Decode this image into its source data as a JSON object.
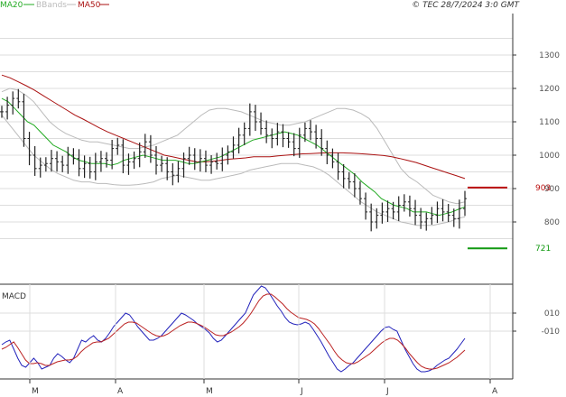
{
  "header": {
    "legend": [
      {
        "label": "MA20",
        "color": "#22aa22"
      },
      {
        "label": "BBands",
        "color": "#bbbbbb"
      },
      {
        "label": "MA50",
        "color": "#aa1111"
      }
    ],
    "copyright": "© TEC 28/7/2024 3:0 GMT"
  },
  "panels": {
    "macd_label": "MACD"
  },
  "chart_data": [
    {
      "type": "candlestick",
      "title": "",
      "ylim": [
        690,
        1400
      ],
      "yticks": [
        800,
        900,
        1000,
        1100,
        1200,
        1300
      ],
      "ytick_labels": [
        "800",
        "900",
        "1000",
        "1100",
        "1200",
        "1300"
      ],
      "xtick_labels": [
        "M",
        "A",
        "M",
        "J",
        "J",
        "A"
      ],
      "xtick_index": [
        8,
        30,
        52,
        74,
        96,
        118
      ],
      "closes": [
        1130,
        1150,
        1170,
        1160,
        1050,
        1000,
        960,
        970,
        975,
        990,
        980,
        970,
        1000,
        990,
        960,
        975,
        950,
        980,
        990,
        985,
        1020,
        1030,
        970,
        980,
        990,
        1010,
        1040,
        1000,
        970,
        975,
        950,
        940,
        960,
        990,
        1000,
        980,
        990,
        970,
        980,
        975,
        1000,
        1010,
        1030,
        1060,
        1080,
        1130,
        1100,
        1080,
        1060,
        1050,
        1070,
        1050,
        1040,
        1020,
        1060,
        1080,
        1070,
        1050,
        1020,
        1000,
        980,
        950,
        930,
        920,
        900,
        870,
        830,
        800,
        820,
        830,
        840,
        830,
        850,
        860,
        840,
        820,
        800,
        810,
        820,
        840,
        830,
        820,
        810,
        840,
        870
      ],
      "series": [
        {
          "name": "MA20",
          "color": "#22aa22",
          "values": [
            1170,
            1160,
            1140,
            1120,
            1100,
            1090,
            1070,
            1050,
            1030,
            1020,
            1010,
            995,
            985,
            980,
            975,
            975,
            975,
            970,
            975,
            985,
            990,
            995,
            1000,
            995,
            990,
            985,
            985,
            985,
            980,
            975,
            975,
            980,
            985,
            990,
            995,
            1005,
            1015,
            1025,
            1035,
            1045,
            1050,
            1055,
            1060,
            1065,
            1070,
            1065,
            1060,
            1050,
            1040,
            1030,
            1015,
            1000,
            985,
            970,
            955,
            940,
            920,
            905,
            890,
            870,
            860,
            850,
            845,
            840,
            830,
            830,
            830,
            825,
            820,
            825,
            830,
            838,
            845
          ]
        },
        {
          "name": "MA50",
          "color": "#aa1111",
          "values": [
            1240,
            1232,
            1220,
            1208,
            1195,
            1180,
            1165,
            1150,
            1135,
            1120,
            1108,
            1095,
            1082,
            1070,
            1060,
            1050,
            1040,
            1030,
            1020,
            1010,
            1000,
            995,
            990,
            985,
            980,
            980,
            982,
            985,
            988,
            990,
            992,
            995,
            995,
            995,
            998,
            1000,
            1002,
            1004,
            1005,
            1006,
            1007,
            1007,
            1007,
            1006,
            1005,
            1003,
            1001,
            999,
            995,
            990,
            984,
            978,
            970,
            962,
            954,
            946,
            938,
            930
          ]
        },
        {
          "name": "BBands",
          "color": "#bbbbbb",
          "upper": [
            1190,
            1200,
            1195,
            1180,
            1160,
            1130,
            1100,
            1080,
            1065,
            1055,
            1045,
            1040,
            1040,
            1035,
            1030,
            1025,
            1020,
            1020,
            1025,
            1030,
            1040,
            1050,
            1060,
            1080,
            1100,
            1120,
            1135,
            1140,
            1140,
            1135,
            1130,
            1120,
            1110,
            1100,
            1095,
            1090,
            1090,
            1095,
            1100,
            1110,
            1120,
            1130,
            1140,
            1140,
            1135,
            1125,
            1110,
            1080,
            1040,
            1000,
            960,
            935,
            920,
            900,
            880,
            870,
            860,
            855,
            860
          ],
          "lower": [
            1120,
            1090,
            1060,
            1030,
            1000,
            980,
            960,
            945,
            935,
            925,
            920,
            920,
            915,
            915,
            912,
            910,
            910,
            912,
            915,
            920,
            930,
            935,
            940,
            935,
            930,
            925,
            925,
            930,
            935,
            940,
            945,
            955,
            960,
            965,
            970,
            975,
            975,
            975,
            970,
            965,
            955,
            940,
            920,
            900,
            880,
            860,
            845,
            830,
            820,
            810,
            800,
            795,
            790,
            790,
            790,
            795,
            800,
            810,
            815
          ]
        }
      ]
    },
    {
      "type": "line",
      "title": "MACD",
      "ylim": [
        -60,
        50
      ],
      "yticks": [
        10,
        -10
      ],
      "ytick_labels": [
        "010",
        "-010"
      ],
      "series": [
        {
          "name": "MACD",
          "color": "#2222bb",
          "values": [
            -25,
            -22,
            -20,
            -30,
            -40,
            -48,
            -50,
            -45,
            -40,
            -45,
            -52,
            -50,
            -48,
            -40,
            -35,
            -38,
            -42,
            -45,
            -40,
            -30,
            -20,
            -22,
            -18,
            -15,
            -20,
            -22,
            -18,
            -12,
            -5,
            0,
            5,
            10,
            8,
            2,
            -5,
            -10,
            -15,
            -20,
            -20,
            -18,
            -15,
            -10,
            -5,
            0,
            5,
            10,
            8,
            5,
            2,
            -2,
            -5,
            -8,
            -12,
            -18,
            -22,
            -20,
            -15,
            -10,
            -5,
            0,
            5,
            10,
            20,
            30,
            35,
            40,
            38,
            32,
            25,
            18,
            12,
            5,
            0,
            -2,
            -3,
            -2,
            0,
            -2,
            -8,
            -15,
            -22,
            -30,
            -38,
            -45,
            -52,
            -55,
            -52,
            -48,
            -45,
            -40,
            -35,
            -30,
            -25,
            -20,
            -15,
            -10,
            -6,
            -5,
            -8,
            -10,
            -20,
            -30,
            -38,
            -46,
            -52,
            -55,
            -55,
            -54,
            -52,
            -48,
            -45,
            -42,
            -40,
            -35,
            -30,
            -24,
            -18
          ]
        },
        {
          "name": "Signal",
          "color": "#bb2222",
          "values": [
            -30,
            -28,
            -25,
            -22,
            -28,
            -35,
            -42,
            -46,
            -46,
            -45,
            -46,
            -48,
            -48,
            -46,
            -44,
            -43,
            -42,
            -42,
            -41,
            -38,
            -33,
            -29,
            -26,
            -23,
            -22,
            -22,
            -20,
            -18,
            -14,
            -10,
            -6,
            -2,
            0,
            0,
            -1,
            -4,
            -7,
            -10,
            -13,
            -15,
            -16,
            -15,
            -13,
            -10,
            -7,
            -4,
            -2,
            0,
            0,
            -1,
            -3,
            -5,
            -8,
            -11,
            -14,
            -15,
            -15,
            -13,
            -11,
            -8,
            -5,
            -1,
            4,
            10,
            17,
            24,
            29,
            31,
            31,
            28,
            24,
            20,
            15,
            11,
            8,
            5,
            4,
            3,
            1,
            -2,
            -7,
            -13,
            -19,
            -25,
            -32,
            -38,
            -42,
            -45,
            -46,
            -46,
            -44,
            -41,
            -38,
            -35,
            -31,
            -27,
            -23,
            -20,
            -18,
            -18,
            -20,
            -24,
            -29,
            -35,
            -40,
            -45,
            -49,
            -51,
            -52,
            -52,
            -51,
            -49,
            -47,
            -45,
            -42,
            -39,
            -35,
            -31
          ]
        }
      ]
    }
  ],
  "markers": [
    {
      "label": "903",
      "value": 903,
      "color": "#bb1111"
    },
    {
      "label": "721",
      "value": 721,
      "color": "#119911"
    }
  ],
  "colors": {
    "grid": "#dddddd",
    "candle": "#222222",
    "axis": "#333333",
    "text": "#555555"
  }
}
